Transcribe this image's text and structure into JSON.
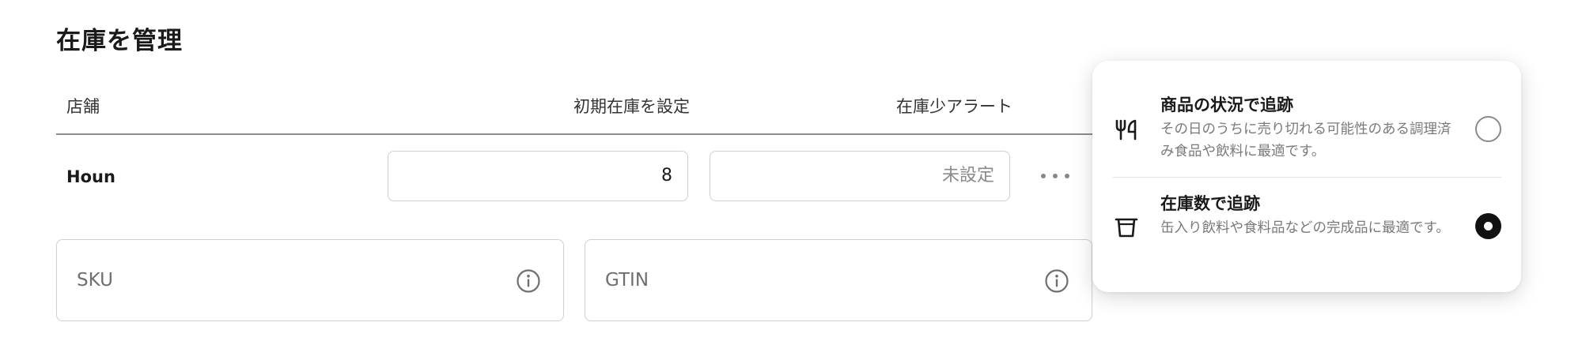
{
  "section": {
    "title": "在庫を管理"
  },
  "table": {
    "headers": {
      "store": "店舗",
      "initial_stock": "初期在庫を設定",
      "low_stock_alert": "在庫少アラート"
    },
    "row": {
      "store_name": "Houn",
      "initial_stock_value": "8",
      "low_stock_value": "未設定"
    }
  },
  "fields": {
    "sku_label": "SKU",
    "gtin_label": "GTIN"
  },
  "tracking_popover": {
    "options": [
      {
        "title": "商品の状況で追跡",
        "description": "その日のうちに売り切れる可能性のある調理済み食品や飲料に最適です。",
        "icon": "fork-knife-icon",
        "selected": false
      },
      {
        "title": "在庫数で追跡",
        "description": "缶入り飲料や食料品などの完成品に最適です。",
        "icon": "cup-icon",
        "selected": true
      }
    ]
  },
  "colors": {
    "border": "#cfcfcf",
    "text_muted": "#7a7a7a",
    "radio_selected": "#111111"
  }
}
